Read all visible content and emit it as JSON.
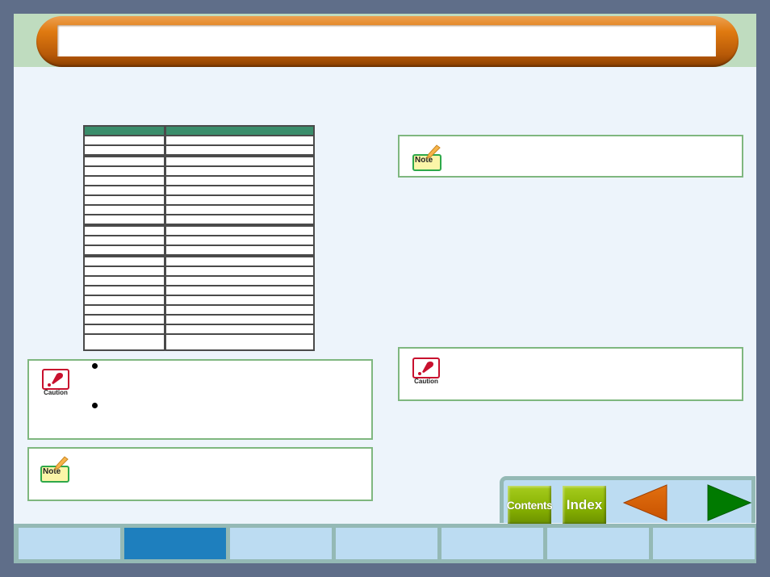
{
  "header": {
    "title": ""
  },
  "spec_table": {
    "columns": [
      "",
      ""
    ],
    "rows": [
      [
        "",
        ""
      ],
      [
        "",
        ""
      ],
      [
        "",
        ""
      ],
      [
        "",
        ""
      ],
      [
        "",
        ""
      ],
      [
        "",
        ""
      ],
      [
        "",
        ""
      ],
      [
        "",
        ""
      ],
      [
        "",
        ""
      ],
      [
        "",
        ""
      ],
      [
        "",
        ""
      ],
      [
        "",
        ""
      ],
      [
        "",
        ""
      ],
      [
        "",
        ""
      ],
      [
        "",
        ""
      ],
      [
        "",
        ""
      ],
      [
        "",
        ""
      ],
      [
        "",
        ""
      ],
      [
        "",
        ""
      ],
      [
        "",
        ""
      ],
      [
        "",
        ""
      ]
    ]
  },
  "left_caution": {
    "label": "Caution",
    "icon": "caution-icon",
    "bullets": [
      "",
      ""
    ]
  },
  "left_note": {
    "label": "Note",
    "icon": "note-icon",
    "text": ""
  },
  "right_note": {
    "label": "Note",
    "icon": "note-icon",
    "text": ""
  },
  "right_caution": {
    "label": "Caution",
    "icon": "caution-icon",
    "text": ""
  },
  "nav": {
    "contents_label": "Contents",
    "index_label": "Index",
    "prev_icon": "left-arrow-icon",
    "next_icon": "right-arrow-icon"
  },
  "tabs": [
    {
      "label": "",
      "active": false
    },
    {
      "label": "",
      "active": true
    },
    {
      "label": "",
      "active": false
    },
    {
      "label": "",
      "active": false
    },
    {
      "label": "",
      "active": false
    },
    {
      "label": "",
      "active": false
    },
    {
      "label": "",
      "active": false
    }
  ],
  "colors": {
    "frame": "#5f6e89",
    "page_bg": "#edf4fb",
    "header_band": "#bfdcbf",
    "title_orange": "#e07a10",
    "table_header": "#3a8d6b",
    "box_border": "#7fb77f",
    "nav_green": "#86b000",
    "prev_arrow": "#d95f00",
    "next_arrow": "#007a00",
    "tab_active": "#1e7fbe",
    "tab_inactive": "#bcdcf2"
  }
}
